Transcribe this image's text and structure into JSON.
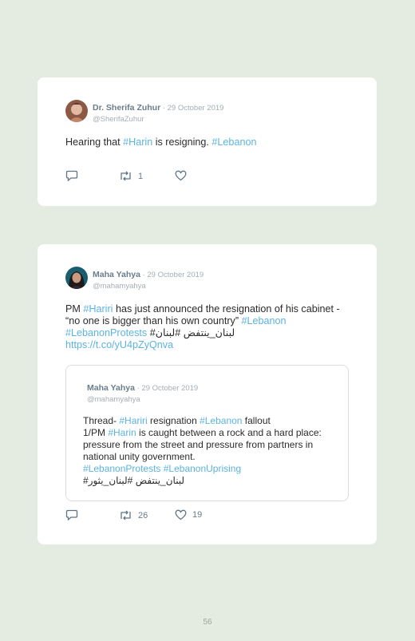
{
  "tweet1": {
    "author": "Dr. Sherifa Zuhur",
    "date": "29 October 2019",
    "handle": "@SherifaZuhur",
    "text_1": "Hearing that ",
    "tag_1": "#Harin",
    "text_2": " is resigning. ",
    "tag_2": "#Lebanon",
    "retweets": "1",
    "likes": ""
  },
  "tweet2": {
    "author": "Maha Yahya",
    "date": "29 October 2019",
    "handle": "@mahamyahya",
    "text_1": "PM ",
    "tag_1": "#Hariri",
    "text_2": " has just announced the resignation of his cabinet - “no one is bigger than his own country” ",
    "tag_2": "#Lebanon",
    "tag_3": "#LebanonProtests",
    "arabic": " #لبنان_ينتفض #لبنان",
    "link": "https://t.co/yU4pZyQnva",
    "retweets": "26",
    "likes": "19",
    "quote": {
      "author": "Maha Yahya",
      "date": "29 October 2019",
      "handle": "@mahamyahya",
      "text_1": "Thread- ",
      "tag_1": "#Hariri",
      "text_2": " resignation ",
      "tag_2": "#Lebanon",
      "text_3": " fallout",
      "text_4": "1/PM ",
      "tag_3": "#Harin",
      "text_5": " is caught between a rock and a hard place: pressure from the street and pressure from partners in national unity government.",
      "tag_4": "#LebanonProtests",
      "tag_5": "#LebanonUprising",
      "arabic": "#لبنان_ينتفض #لبنان_يثور"
    }
  },
  "separator": " · ",
  "page_number": "56",
  "colors": {
    "background": "#e4ece2",
    "card": "#ffffff",
    "link": "#5bb3e0",
    "name": "#6b7d8a",
    "meta": "#a4aeb6"
  },
  "icons": [
    "reply-icon",
    "retweet-icon",
    "like-icon"
  ]
}
